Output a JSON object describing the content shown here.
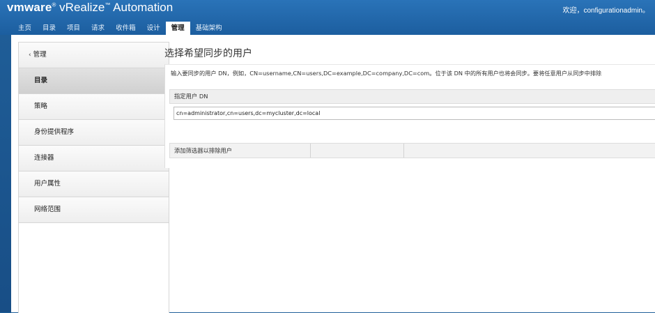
{
  "header": {
    "brand_logo": "vmware",
    "brand_product": "vRealize",
    "brand_product2": "Automation",
    "welcome": "欢迎，configurationadmin。"
  },
  "tabs": [
    {
      "label": "主页"
    },
    {
      "label": "目录"
    },
    {
      "label": "项目"
    },
    {
      "label": "请求"
    },
    {
      "label": "收件箱"
    },
    {
      "label": "设计"
    },
    {
      "label": "管理"
    },
    {
      "label": "基础架构"
    }
  ],
  "sidebar": {
    "back_label": "管理",
    "items": [
      {
        "label": "目录"
      },
      {
        "label": "策略"
      },
      {
        "label": "身份提供程序"
      },
      {
        "label": "连接器"
      },
      {
        "label": "用户属性"
      },
      {
        "label": "网络范围"
      }
    ]
  },
  "page": {
    "title": "选择希望同步的用户",
    "instructions": "输入要同步的用户 DN，例如，CN=username,CN=users,DC=example,DC=company,DC=com。位于该 DN 中的所有用户也将会同步。要将任意用户从同步中排除",
    "dn_header": "指定用户 DN",
    "dn_value": "cn=administrator,cn=users,dc=mycluster,dc=local",
    "filter_label": "添加筛选器以排除用户"
  }
}
